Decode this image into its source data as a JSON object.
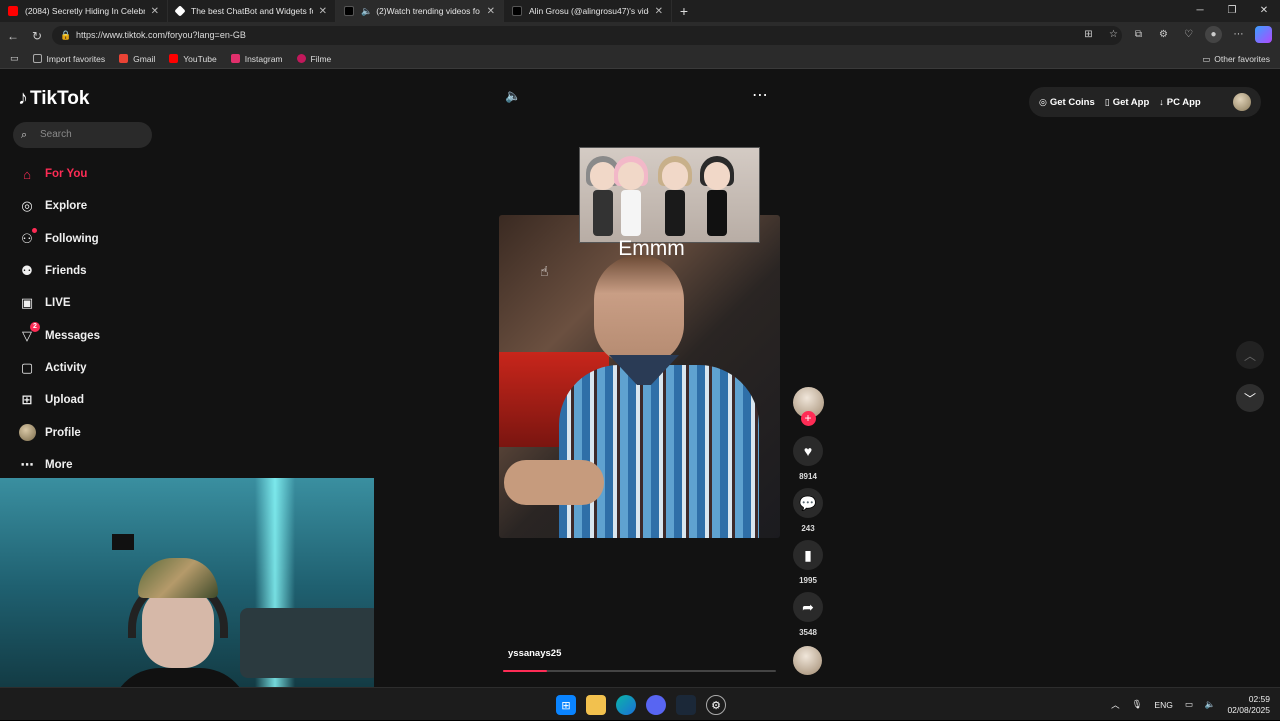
{
  "browser": {
    "tabs": [
      {
        "title": "(2084) Secretly Hiding In Celebrit",
        "favicon_color": "#ff0000",
        "active": false
      },
      {
        "title": "The best ChatBot and Widgets fo",
        "favicon_color": "#ffffff",
        "active": false
      },
      {
        "title": "(2)Watch trending videos fo",
        "favicon_color": "#000000",
        "active": true
      },
      {
        "title": "Alin Grosu (@alingrosu47)'s vide",
        "favicon_color": "#000000",
        "active": false
      }
    ],
    "new_tab": "+",
    "url": "https://www.tiktok.com/foryou?lang=en-GB",
    "favorites": [
      {
        "label": "Import favorites",
        "color": "#888888"
      },
      {
        "label": "Gmail",
        "color": "#ea4335"
      },
      {
        "label": "YouTube",
        "color": "#ff0000"
      },
      {
        "label": "Instagram",
        "color": "#e1306c"
      },
      {
        "label": "Filme",
        "color": "#c2185b"
      }
    ],
    "other_favorites": "Other favorites"
  },
  "tiktok": {
    "logo": "TikTok",
    "search_placeholder": "Search",
    "nav": [
      {
        "label": "For You",
        "icon": "home-icon",
        "active": true
      },
      {
        "label": "Explore",
        "icon": "compass-icon"
      },
      {
        "label": "Following",
        "icon": "following-icon"
      },
      {
        "label": "Friends",
        "icon": "friends-icon"
      },
      {
        "label": "LIVE",
        "icon": "live-icon"
      },
      {
        "label": "Messages",
        "icon": "messages-icon",
        "badge": "2"
      },
      {
        "label": "Activity",
        "icon": "activity-icon"
      },
      {
        "label": "Upload",
        "icon": "upload-icon"
      },
      {
        "label": "Profile",
        "icon": "profile-avatar"
      },
      {
        "label": "More",
        "icon": "more-icon"
      }
    ],
    "topbar": {
      "get_coins": "Get Coins",
      "get_app": "Get App",
      "pc_app": "PC App"
    },
    "video": {
      "caption": "Emmm",
      "author": "yssanays25",
      "progress": 0.16,
      "likes": "8914",
      "comments": "243",
      "saves": "1995",
      "shares": "3548"
    }
  },
  "taskbar": {
    "language": "ENG",
    "time": "02:59",
    "date": "02/08/2025"
  }
}
